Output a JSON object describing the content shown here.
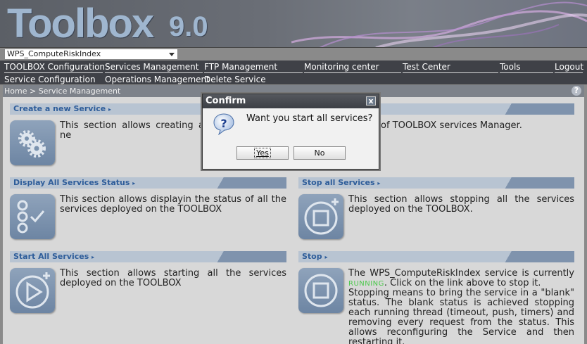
{
  "banner": {
    "logo_text": "Toolbox",
    "logo_version": "9.0"
  },
  "service_select": {
    "value": "WPS_ComputeRiskIndex"
  },
  "menu": {
    "row1": [
      "TOOLBOX Configuration",
      "Services Management",
      "FTP Management",
      "Monitoring center",
      "Test Center",
      "Tools",
      "Logout"
    ],
    "row2": [
      "Service Configuration",
      "Operations Management",
      "Delete Service"
    ]
  },
  "breadcrumb": "Home > Service Management",
  "help_icon": "?",
  "sections": {
    "create": {
      "title": "Create a new Service",
      "desc_left": "This section allows creating a ne",
      "desc_right": "of TOOLBOX services Manager."
    },
    "display": {
      "title": "Display All Services Status",
      "desc": "This section allows displayin the status of all the services deployed on the TOOLBOX"
    },
    "stop_all": {
      "title": "Stop all Services",
      "desc": "This section allows stopping all the services deployed on the TOOLBOX."
    },
    "start_all": {
      "title": "Start All Services",
      "desc": "This section allows starting all the services deployed on the TOOLBOX"
    },
    "stop": {
      "title": "Stop",
      "desc_pre": "The WPS_ComputeRiskIndex service is currently",
      "status": "RUNNING",
      "desc_post": ". Click on the link above to stop it.",
      "desc_more": "Stopping means to bring the service in a \"blank\" status. The blank status is achieved stopping each running thread (timeout, push, timers) and removing every request from the status. This allows reconfiguring the Service and then restarting it."
    }
  },
  "dialog": {
    "title": "Confirm",
    "message": "Want you start all services?",
    "yes_label": "Yes",
    "no_label": "No",
    "close_glyph": "x"
  },
  "colors": {
    "menubar": "#3f4147",
    "section_label": "#2e5d9a",
    "running": "#4cc84c"
  }
}
